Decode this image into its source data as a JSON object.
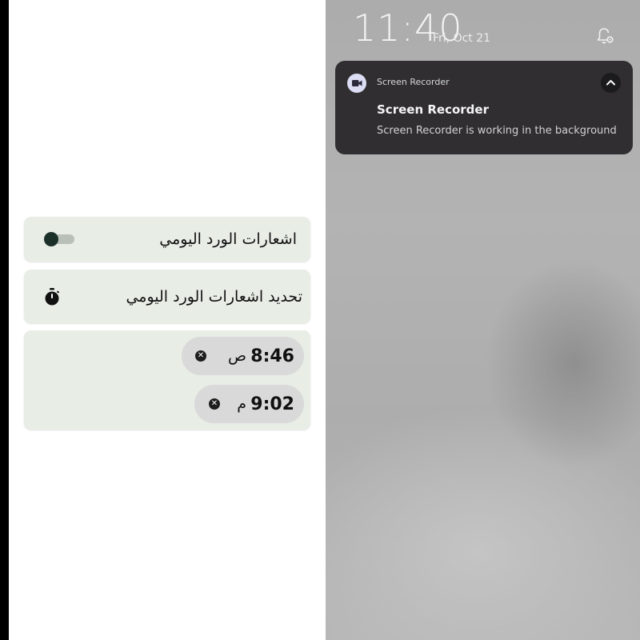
{
  "app": {
    "daily_notifications_label": "اشعارات الورد اليومي",
    "daily_notifications_enabled": false,
    "set_notifications_label": "تحديد اشعارات الورد اليومي",
    "times": [
      {
        "time": "8:46",
        "period": "ص"
      },
      {
        "time": "9:02",
        "period": "م"
      }
    ]
  },
  "shade": {
    "clock": "11:40",
    "date": "Fri, Oct 21",
    "notification": {
      "app_name": "Screen Recorder",
      "title": "Screen Recorder",
      "body": "Screen Recorder is working in the background"
    }
  },
  "icons": {
    "toggle": "switch-off",
    "timer": "stopwatch-icon",
    "remove_time": "close-circle-icon",
    "recorder": "video-camera-icon",
    "expand": "chevron-up-icon",
    "notification_settings": "bell-settings-icon"
  },
  "colors": {
    "card_bg": "#e8ede6",
    "chip_bg": "#d9d9d9",
    "toggle_thumb": "#1c302a",
    "notification_bg": "#302e31"
  }
}
